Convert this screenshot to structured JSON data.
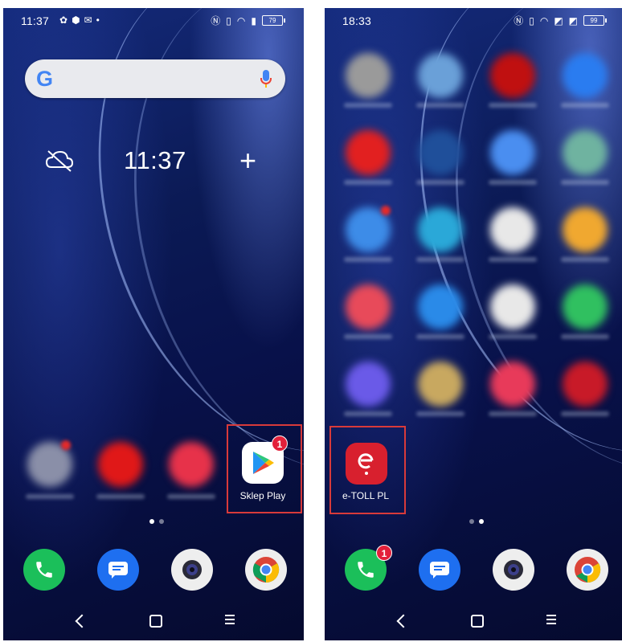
{
  "left_screen": {
    "status_time": "11:37",
    "battery": "79",
    "clock": "11:37",
    "plus": "+",
    "highlighted_app": {
      "label": "Sklep Play",
      "badge": "1"
    }
  },
  "right_screen": {
    "status_time": "18:33",
    "battery": "99",
    "highlighted_app": {
      "label": "e-TOLL PL"
    },
    "phone_badge": "1"
  },
  "icons": {
    "search_logo": "G",
    "dock": [
      "phone-icon",
      "messages-icon",
      "camera-icon",
      "chrome-icon"
    ]
  },
  "colors": {
    "highlight": "#d83a3a",
    "badge": "#e3203a",
    "etoll": "#d8202e",
    "phone_green": "#1bbf5a",
    "messages_blue": "#1e6ff0"
  }
}
